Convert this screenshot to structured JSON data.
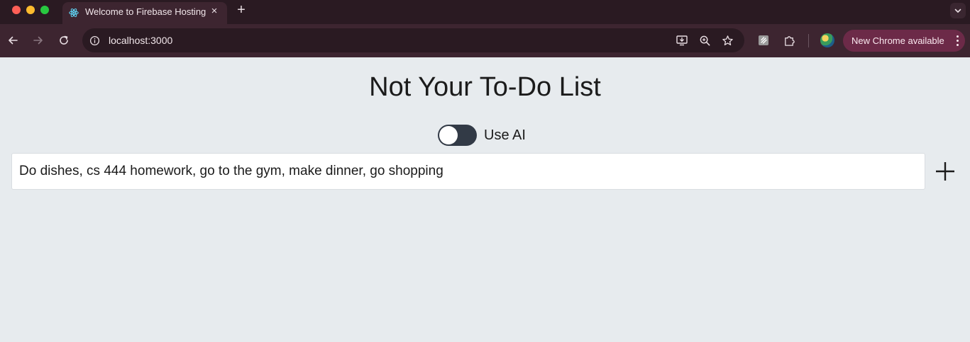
{
  "browser": {
    "tab": {
      "title": "Welcome to Firebase Hosting",
      "favicon": "react-atom-icon"
    },
    "new_tab_label": "+",
    "close_tab_label": "×",
    "address": {
      "url": "localhost:3000"
    },
    "update_button": {
      "label": "New Chrome available"
    }
  },
  "app": {
    "title": "Not Your To-Do List",
    "ai_toggle": {
      "label": "Use AI",
      "enabled": false
    },
    "task_input": {
      "value": "Do dishes, cs 444 homework, go to the gym, make dinner, go shopping"
    },
    "add_button": {
      "icon": "plus-icon"
    }
  },
  "colors": {
    "tab_strip": "#2a1a22",
    "toolbar": "#3d2530",
    "update_pill": "#6c2a48",
    "page_background": "#e7ebee",
    "toggle_track": "#323a46"
  }
}
